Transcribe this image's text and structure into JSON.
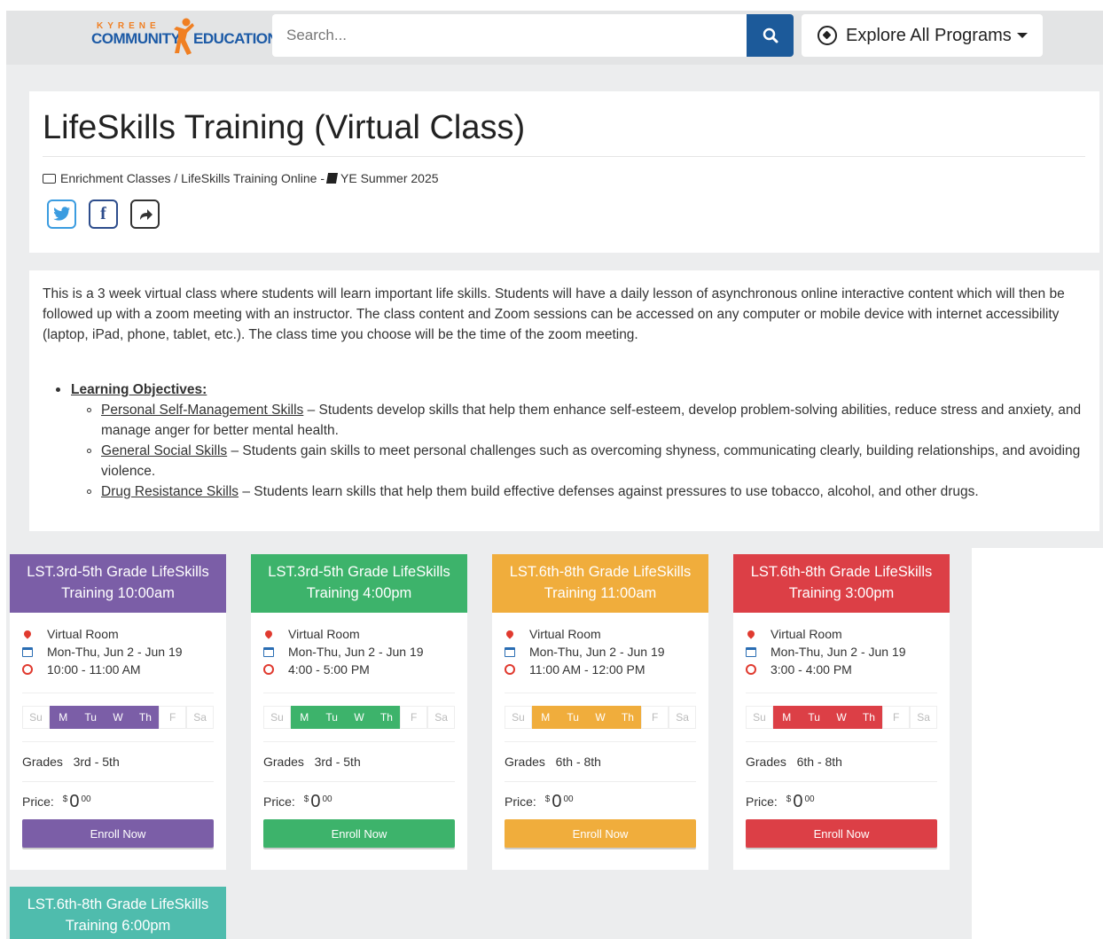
{
  "nav": {
    "logo_top": "KYRENE",
    "logo_left": "COMMUNITY",
    "logo_right": "EDUCATION",
    "search_placeholder": "Search...",
    "explore_label": "Explore All Programs"
  },
  "page": {
    "title": "LifeSkills Training (Virtual Class)",
    "breadcrumb": "Enrichment Classes / LifeSkills Training Online -",
    "session": "YE Summer 2025"
  },
  "description": {
    "intro": "This is a 3 week virtual class where students will learn important life skills. Students will have a daily lesson of asynchronous online interactive content which will then be followed up with a zoom meeting with an instructor. The class content and Zoom sessions can be accessed on any computer or mobile device with internet accessibility (laptop, iPad, phone, tablet, etc.). The class time you choose will be the time of the zoom meeting.",
    "objectives_heading": "Learning Objectives:",
    "objectives": [
      {
        "name": "Personal Self-Management Skills",
        "text": " – Students develop skills that help them enhance self-esteem, develop problem-solving abilities, reduce stress and anxiety, and manage anger for better mental health."
      },
      {
        "name": "General Social Skills",
        "text": " – Students gain skills to meet personal challenges such as overcoming shyness, communicating clearly, building relationships, and avoiding violence."
      },
      {
        "name": "Drug Resistance Skills",
        "text": " – Students learn skills that help them build effective defenses against pressures to use tobacco, alcohol, and other drugs."
      }
    ]
  },
  "day_labels": [
    "Su",
    "M",
    "Tu",
    "W",
    "Th",
    "F",
    "Sa"
  ],
  "cards": [
    {
      "title": "LST.3rd-5th Grade LifeSkills Training 10:00am",
      "color": "#7b5ea7",
      "location": "Virtual Room",
      "dates": "Mon-Thu, Jun 2 - Jun 19",
      "time": "10:00 - 11:00 AM",
      "grades_label": "Grades",
      "grades": "3rd - 5th",
      "price_label": "Price:",
      "currency": "$",
      "amount": "0",
      "cents": "00",
      "enroll": "Enroll Now"
    },
    {
      "title": "LST.3rd-5th Grade LifeSkills Training 4:00pm",
      "color": "#3db36b",
      "location": "Virtual Room",
      "dates": "Mon-Thu, Jun 2 - Jun 19",
      "time": "4:00 - 5:00 PM",
      "grades_label": "Grades",
      "grades": "3rd - 5th",
      "price_label": "Price:",
      "currency": "$",
      "amount": "0",
      "cents": "00",
      "enroll": "Enroll Now"
    },
    {
      "title": "LST.6th-8th Grade LifeSkills Training 11:00am",
      "color": "#f0ad3c",
      "location": "Virtual Room",
      "dates": "Mon-Thu, Jun 2 - Jun 19",
      "time": "11:00 AM - 12:00 PM",
      "grades_label": "Grades",
      "grades": "6th - 8th",
      "price_label": "Price:",
      "currency": "$",
      "amount": "0",
      "cents": "00",
      "enroll": "Enroll Now"
    },
    {
      "title": "LST.6th-8th Grade LifeSkills Training 3:00pm",
      "color": "#dc3f46",
      "location": "Virtual Room",
      "dates": "Mon-Thu, Jun 2 - Jun 19",
      "time": "3:00 - 4:00 PM",
      "grades_label": "Grades",
      "grades": "6th - 8th",
      "price_label": "Price:",
      "currency": "$",
      "amount": "0",
      "cents": "00",
      "enroll": "Enroll Now"
    }
  ],
  "card5_title": "LST.6th-8th Grade LifeSkills Training 6:00pm",
  "card5_color": "#4fbcad",
  "colors": {
    "pin": "#e03a2f",
    "calendar": "#2a6db3",
    "clock": "#e03a2f",
    "twitter": "#3b9ce0",
    "facebook": "#2d4d8c",
    "share": "#333333"
  }
}
